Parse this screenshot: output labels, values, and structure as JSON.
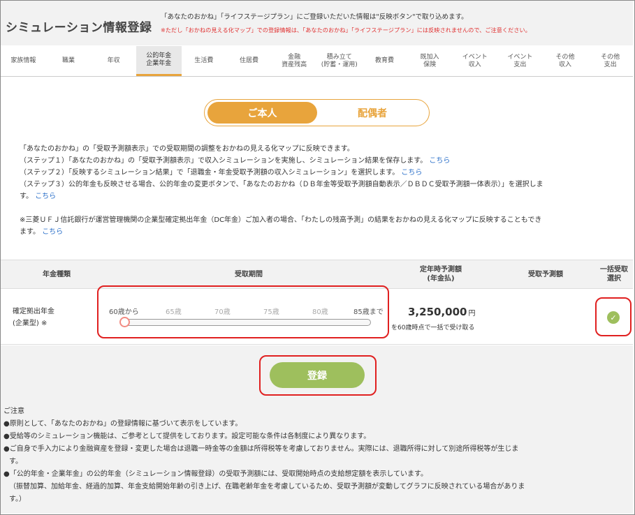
{
  "header": {
    "title": "シミュレーション情報登録",
    "message": "「あなたのおかね」「ライフステージプラン」にご登録いただいた情報は\"反映ボタン\"で取り込めます。",
    "warning": "※ただし「おかねの見える化マップ」での登録情報は、「あなたのおかね」「ライフステージプラン」には反映されませんので、ご注意ください。"
  },
  "tabs": [
    {
      "label": "家族情報"
    },
    {
      "label": "職業"
    },
    {
      "label": "年収"
    },
    {
      "label": "公的年金\n企業年金"
    },
    {
      "label": "生活費"
    },
    {
      "label": "住居費"
    },
    {
      "label": "金融\n資産残高"
    },
    {
      "label": "積み立て\n(貯蓄・運用)"
    },
    {
      "label": "教育費"
    },
    {
      "label": "既加入\n保険"
    },
    {
      "label": "イベント\n収入"
    },
    {
      "label": "イベント\n支出"
    },
    {
      "label": "その他\n収入"
    },
    {
      "label": "その他\n支出"
    }
  ],
  "active_tab_index": 3,
  "person_toggle": {
    "self_label": "ご本人",
    "spouse_label": "配偶者",
    "selected": "self"
  },
  "instructions": {
    "line1": "「あなたのおかね」の「受取予測額表示」での受取期間の調整をおかねの見える化マップに反映できます。",
    "step1": "（ステップ１）「あなたのおかね」の「受取予測額表示」で収入シミュレーションを実施し、シミュレーション結果を保存します。",
    "step2": "（ステップ２）「反映するシミュレーション結果」で「退職金・年金受取予測額の収入シミュレーション」を選択します。",
    "step3": "（ステップ３）公的年金も反映させる場合、公的年金の変更ボタンで、「あなたのおかね（ＤＢ年金等受取予測額自動表示／ＤＢＤＣ受取予測額一体表示）」を選択しま",
    "step3_cont": "す。",
    "note": "※三菱ＵＦＪ信託銀行が運営管理機関の企業型確定拠出年金（DC年金）ご加入者の場合、「わたしの残高予測」の結果をおかねの見える化マップに反映することもでき",
    "note_cont": "ます。",
    "link_text": "こちら"
  },
  "table": {
    "headers": {
      "type": "年金種類",
      "period": "受取期間",
      "retire_amount": "定年時予測額\n(年金払)",
      "receive_amount": "受取予測額",
      "lump_sum": "一括受取\n選択"
    },
    "row": {
      "label_line1": "確定拠出年金",
      "label_line2": "(企業型) ※",
      "ticks": [
        "60歳から",
        "65歳",
        "70歳",
        "75歳",
        "80歳",
        "85歳まで"
      ],
      "slider_value": 60,
      "amount": "3,250,000",
      "amount_unit": "円",
      "amount_note": "を60歳時点で一括で受け取る",
      "lump_sum_checked": true
    }
  },
  "submit_label": "登録",
  "caution": {
    "title": "ご注意",
    "items": [
      "●原則として、「あなたのおかね」の登録情報に基づいて表示をしています。",
      "●受給等のシミュレーション機能は、ご参考として提供をしております。設定可能な条件は各制度により異なります。",
      "●ご自身で手入力により金融資産を登録・変更した場合は退職一時金等の金額は所得税等を考慮しておりません。実際には、退職所得に対して別途所得税等が生じま",
      "す。",
      "●「公的年金・企業年金」の公的年金（シミュレーション情報登録）の受取予測額には、受取開始時点の支給想定額を表示しています。",
      "（振替加算、加給年金、経過的加算、年金支給開始年齢の引き上げ、在職老齢年金を考慮しているため、受取予測額が変動してグラフに反映されている場合がありま",
      "す。）"
    ]
  },
  "colors": {
    "accent": "#e8a43c",
    "submit": "#9ebf5d",
    "highlight": "#e02020",
    "link": "#2a6fc9"
  }
}
